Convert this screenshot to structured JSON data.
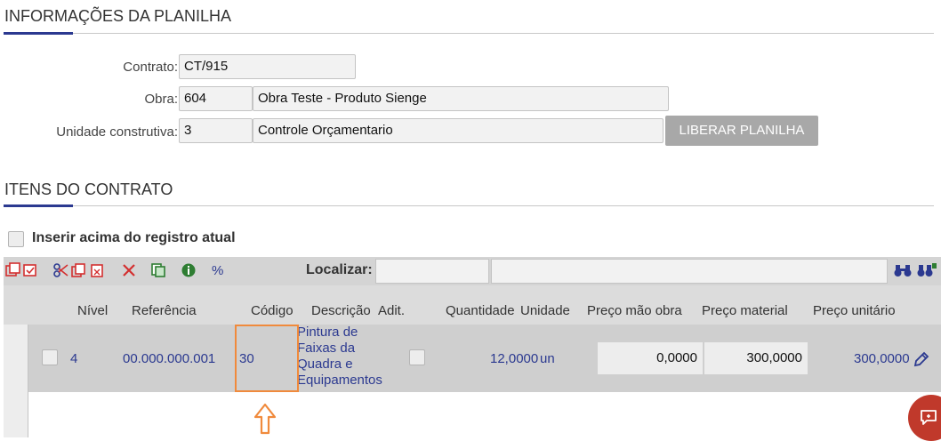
{
  "sections": {
    "planilha_title": "INFORMAÇÕES DA PLANILHA",
    "itens_title": "ITENS DO CONTRATO"
  },
  "form": {
    "contrato_label": "Contrato:",
    "contrato_value": "CT/915",
    "obra_label": "Obra:",
    "obra_code": "604",
    "obra_name": "Obra Teste - Produto Sienge",
    "unidade_label": "Unidade construtiva:",
    "unidade_code": "3",
    "unidade_name": "Controle Orçamentario",
    "liberar_label": "LIBERAR PLANILHA"
  },
  "options": {
    "inserir_acima_label": "Inserir acima do registro atual"
  },
  "toolbar": {
    "localizar_label": "Localizar:",
    "percent_label": "%"
  },
  "grid": {
    "columns": [
      "Nível",
      "Referência",
      "Código",
      "Descrição",
      "Adit.",
      "Quantidade",
      "Unidade",
      "Preço mão obra",
      "Preço material",
      "Preço unitário"
    ],
    "rows": [
      {
        "nivel": "4",
        "referencia": "00.000.000.001",
        "codigo": "30",
        "descricao": [
          "Pintura de",
          "Faixas da",
          "Quadra e",
          "Equipamentos"
        ],
        "quantidade": "12,0000",
        "unidade": "un",
        "preco_mao_obra": "0,0000",
        "preco_material": "300,0000",
        "preco_unitario": "300,0000"
      }
    ]
  },
  "colors": {
    "accent": "#2b3990",
    "highlight": "#f08a3c",
    "chat_button": "#c0392b"
  }
}
